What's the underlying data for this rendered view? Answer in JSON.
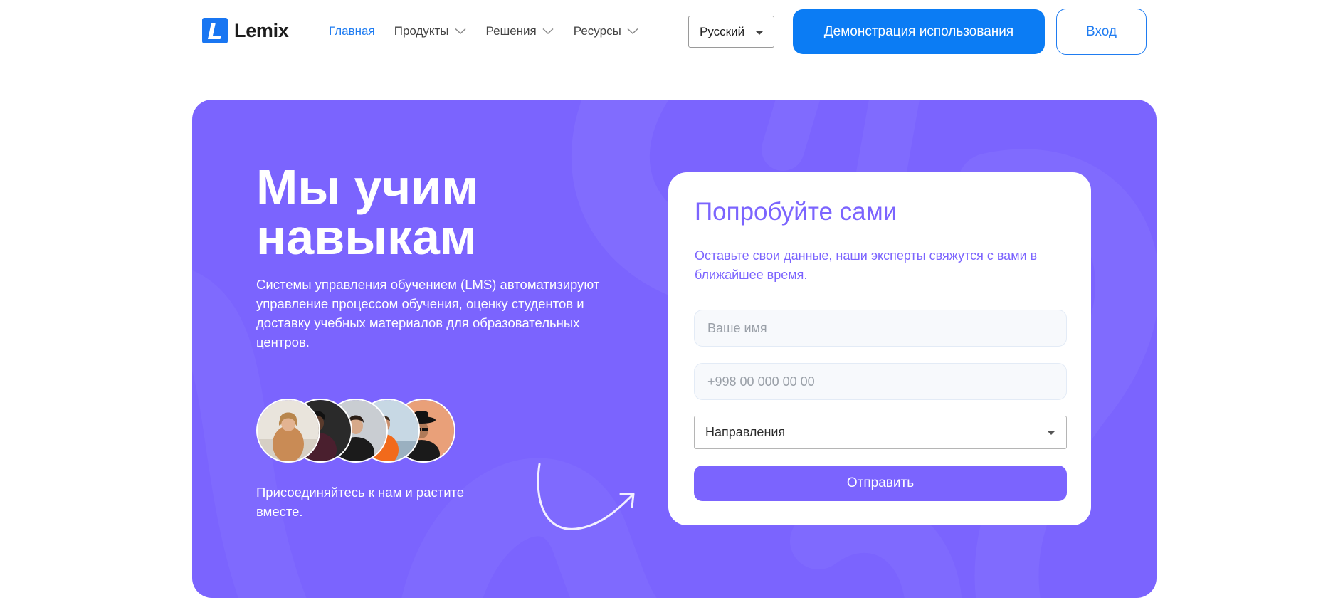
{
  "header": {
    "logo_text": "Lemix",
    "logo_icon": "lemix-logo-icon",
    "nav": [
      {
        "label": "Главная",
        "active": true
      },
      {
        "label": "Продукты",
        "active": false,
        "dropdown": true
      },
      {
        "label": "Решения",
        "active": false,
        "dropdown": true
      },
      {
        "label": "Ресурсы",
        "active": false,
        "dropdown": true
      }
    ],
    "language": "Русский",
    "demo_button": "Демонстрация использования",
    "login_button": "Вход"
  },
  "hero": {
    "title": "Мы учим навыкам",
    "description": "Системы управления обучением (LMS) автоматизируют управление процессом обучения, оценку студентов и доставку учебных материалов для образовательных центров.",
    "join_text": "Присоединяйтесь к нам и растите вместе.",
    "avatar_count": 5
  },
  "form": {
    "title": "Попробуйте сами",
    "subtitle": "Оставьте свои данные, наши эксперты свяжутся с вами в ближайшее время.",
    "name_placeholder": "Ваше имя",
    "phone_placeholder": "+998 00 000 00 00",
    "direction_select": "Направления",
    "submit_label": "Отправить"
  },
  "colors": {
    "brand_blue": "#0b7cf4",
    "hero_purple": "#7b64fe",
    "white": "#ffffff"
  }
}
